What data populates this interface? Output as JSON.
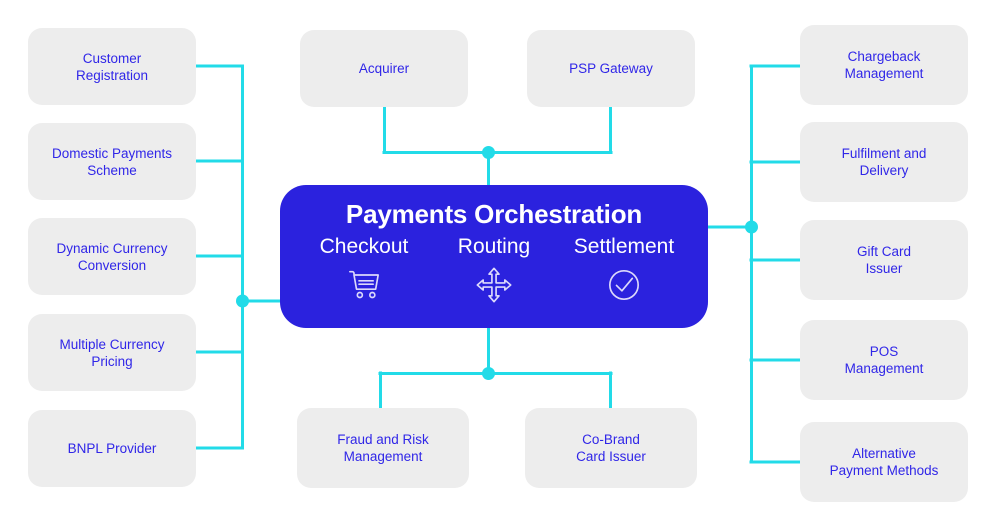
{
  "diagram": {
    "title": "Payments Orchestration ecosystem diagram",
    "colors": {
      "hub_blue": "#2b22de",
      "node_grey": "#ededed",
      "node_text_blue": "#3026e8",
      "connector_cyan": "#22dbe8",
      "background": "#ffffff"
    }
  },
  "hub": {
    "title": "Payments Orchestration",
    "pillars": [
      {
        "label": "Checkout",
        "icon": "shopping-cart-icon"
      },
      {
        "label": "Routing",
        "icon": "four-way-arrows-icon"
      },
      {
        "label": "Settlement",
        "icon": "check-circle-icon"
      }
    ]
  },
  "left_nodes": [
    {
      "label": "Customer Registration",
      "line1": "Customer",
      "line2": "Registration"
    },
    {
      "label": "Domestic Payments Scheme",
      "line1": "Domestic Payments",
      "line2": "Scheme"
    },
    {
      "label": "Dynamic Currency Conversion",
      "line1": "Dynamic Currency",
      "line2": "Conversion"
    },
    {
      "label": "Multiple Currency Pricing",
      "line1": "Multiple Currency",
      "line2": "Pricing"
    },
    {
      "label": "BNPL Provider",
      "line1": "BNPL Provider",
      "line2": ""
    }
  ],
  "right_nodes": [
    {
      "label": "Chargeback Management",
      "line1": "Chargeback",
      "line2": "Management"
    },
    {
      "label": "Fulfilment and Delivery",
      "line1": "Fulfilment and",
      "line2": "Delivery"
    },
    {
      "label": "Gift Card Issuer",
      "line1": "Gift Card",
      "line2": "Issuer"
    },
    {
      "label": "POS Management",
      "line1": "POS",
      "line2": "Management"
    },
    {
      "label": "Alternative Payment Methods",
      "line1": "Alternative",
      "line2": "Payment Methods"
    }
  ],
  "top_nodes": [
    {
      "label": "Acquirer",
      "line1": "Acquirer",
      "line2": ""
    },
    {
      "label": "PSP Gateway",
      "line1": "PSP Gateway",
      "line2": ""
    }
  ],
  "bottom_nodes": [
    {
      "label": "Fraud and Risk Management",
      "line1": "Fraud and Risk",
      "line2": "Management"
    },
    {
      "label": "Co-Brand Card Issuer",
      "line1": "Co-Brand",
      "line2": "Card Issuer"
    }
  ]
}
